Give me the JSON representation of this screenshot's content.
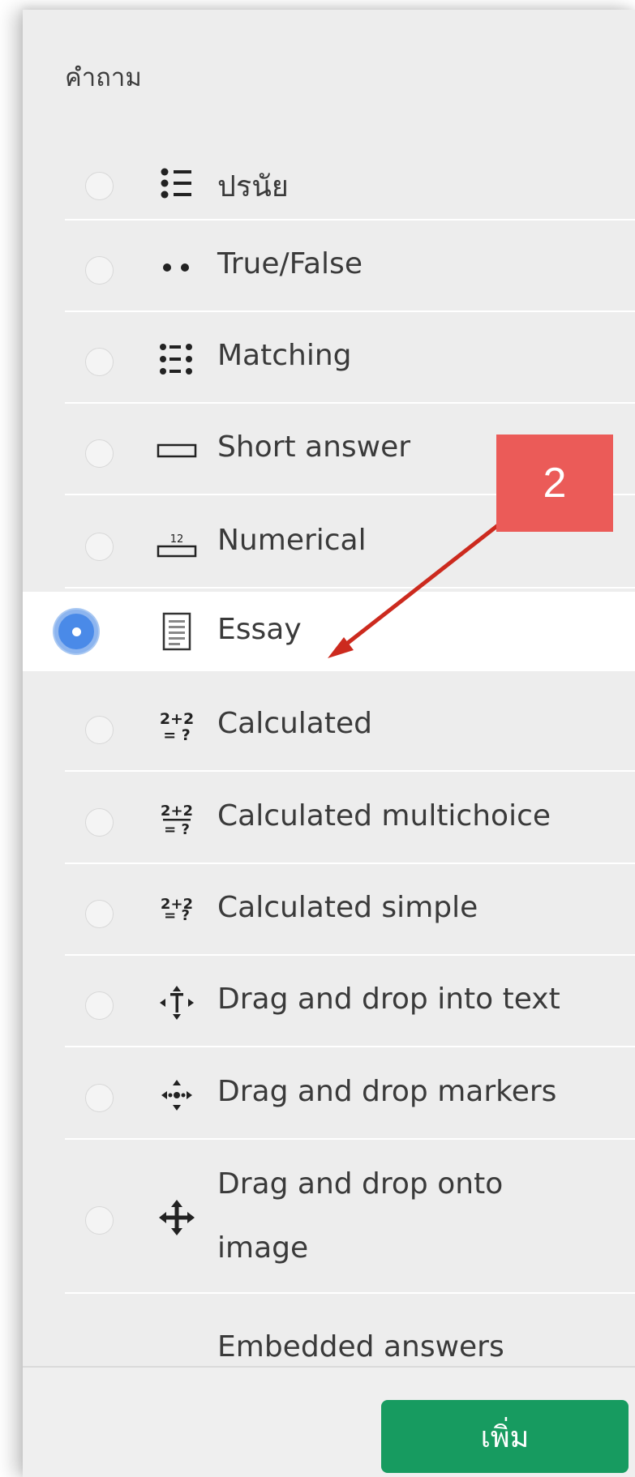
{
  "panel": {
    "heading": "คำถาม",
    "question_types": [
      {
        "label": "ปรนัย",
        "icon": "multichoice-list-icon",
        "selected": false
      },
      {
        "label": "True/False",
        "icon": "true-false-dots-icon",
        "selected": false
      },
      {
        "label": "Matching",
        "icon": "matching-grid-icon",
        "selected": false
      },
      {
        "label": "Short answer",
        "icon": "short-answer-box-icon",
        "selected": false
      },
      {
        "label": "Numerical",
        "icon": "numerical-icon",
        "selected": false
      },
      {
        "label": "Essay",
        "icon": "essay-document-icon",
        "selected": true
      },
      {
        "label": "Calculated",
        "icon": "calculated-icon",
        "selected": false
      },
      {
        "label": "Calculated multichoice",
        "icon": "calculated-multichoice-icon",
        "selected": false
      },
      {
        "label": "Calculated simple",
        "icon": "calculated-simple-icon",
        "selected": false
      },
      {
        "label": "Drag and drop into text",
        "icon": "drag-drop-text-icon",
        "selected": false
      },
      {
        "label": "Drag and drop markers",
        "icon": "drag-drop-markers-icon",
        "selected": false
      },
      {
        "label_line1": "Drag and drop onto",
        "label_line2": "image",
        "icon": "drag-drop-image-icon",
        "selected": false
      },
      {
        "label": "Embedded answers",
        "icon": "embedded-answers-icon",
        "selected": false
      }
    ],
    "icon_glyphs": {
      "numerical_small": "12",
      "calculated_top": "2+2",
      "calculated_bottom": "= ?"
    }
  },
  "footer": {
    "add_button_label": "เพิ่ม"
  },
  "annotation": {
    "callout_number": "2"
  },
  "colors": {
    "accent_blue": "#4a8ae8",
    "add_button_green": "#179b60",
    "callout_red": "#eb5b58",
    "arrow_red": "#cc2a1e"
  }
}
